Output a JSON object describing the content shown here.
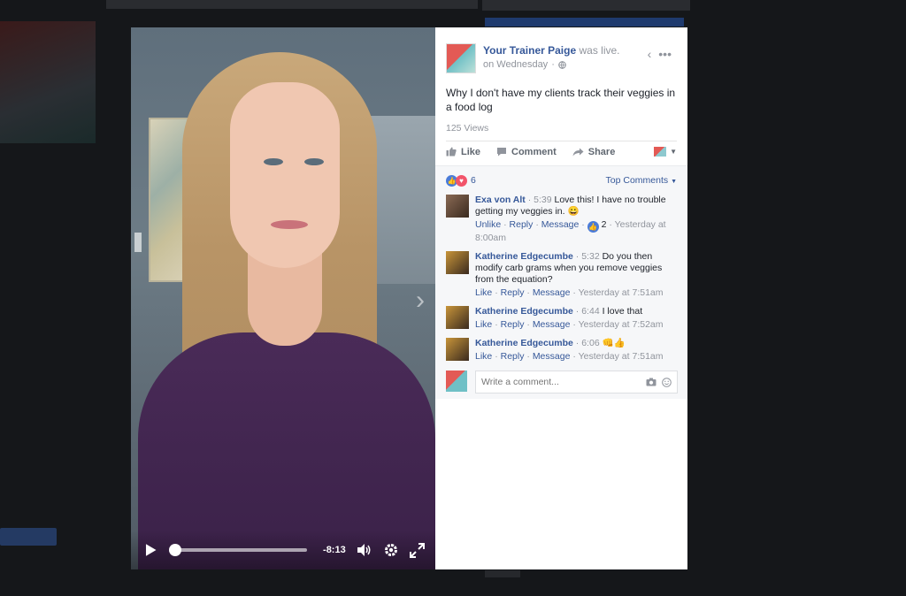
{
  "post": {
    "page_name": "Your Trainer Paige",
    "status": "was live.",
    "when": "on Wednesday",
    "separator": "·",
    "text": "Why I don't have my clients track their veggies in a food log",
    "views": "125 Views"
  },
  "actions": {
    "like": "Like",
    "comment": "Comment",
    "share": "Share"
  },
  "reactions": {
    "count": "6",
    "sort_label": "Top Comments"
  },
  "comments": [
    {
      "name": "Exa von Alt",
      "time": "5:39",
      "text": "Love this! I have no trouble getting my veggies in. 😀",
      "links": [
        "Unlike",
        "Reply",
        "Message"
      ],
      "like_count": "2",
      "stamp": "Yesterday at 8:00am",
      "avatar_color": "#8a6a55"
    },
    {
      "name": "Katherine Edgecumbe",
      "time": "5:32",
      "text": "Do you then modify carb grams when you remove veggies from the equation?",
      "links": [
        "Like",
        "Reply",
        "Message"
      ],
      "stamp": "Yesterday at 7:51am",
      "avatar_color": "#c8953a"
    },
    {
      "name": "Katherine Edgecumbe",
      "time": "6:44",
      "text": "I love that",
      "links": [
        "Like",
        "Reply",
        "Message"
      ],
      "stamp": "Yesterday at 7:52am",
      "avatar_color": "#c8953a"
    },
    {
      "name": "Katherine Edgecumbe",
      "time": "6:06",
      "text": "👊👍",
      "links": [
        "Like",
        "Reply",
        "Message"
      ],
      "stamp": "Yesterday at 7:51am",
      "avatar_color": "#c8953a"
    }
  ],
  "composer": {
    "placeholder": "Write a comment..."
  },
  "player": {
    "time_remaining": "-8:13",
    "progress_fraction": 0.0
  },
  "colors": {
    "link": "#365899",
    "muted": "#90949c",
    "like_reaction": "#4a7bd8",
    "love_reaction": "#f2546a"
  }
}
